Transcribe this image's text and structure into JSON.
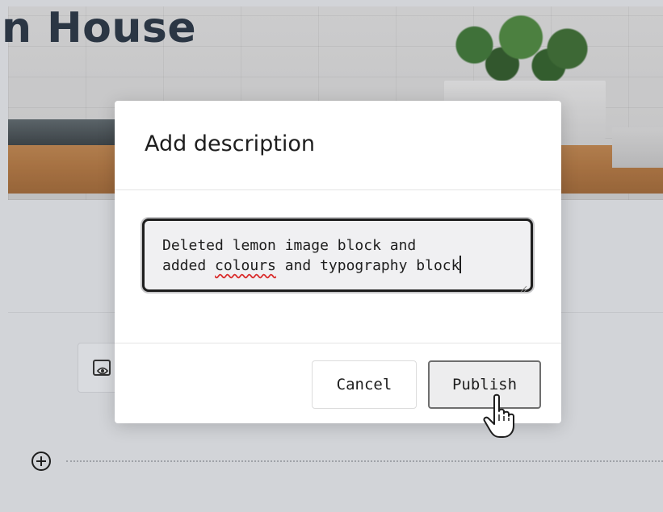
{
  "page": {
    "title": "n House"
  },
  "modal": {
    "title": "Add description",
    "description_line_1": "Deleted lemon image block and",
    "description_line_2_before": "added ",
    "description_line_2_misspelled": "colours",
    "description_line_2_after": " and typography block",
    "cancel_label": "Cancel",
    "publish_label": "Publish"
  },
  "icons": {
    "preview": "eye-preview-icon",
    "add_block": "plus-circle-icon",
    "cursor": "hand-pointer-cursor",
    "resize": "resize-handle-icon"
  },
  "colors": {
    "title_text": "#2b3644",
    "backdrop": "#d2d4d8",
    "modal_bg": "#ffffff",
    "spell_error": "#d92b2b"
  }
}
